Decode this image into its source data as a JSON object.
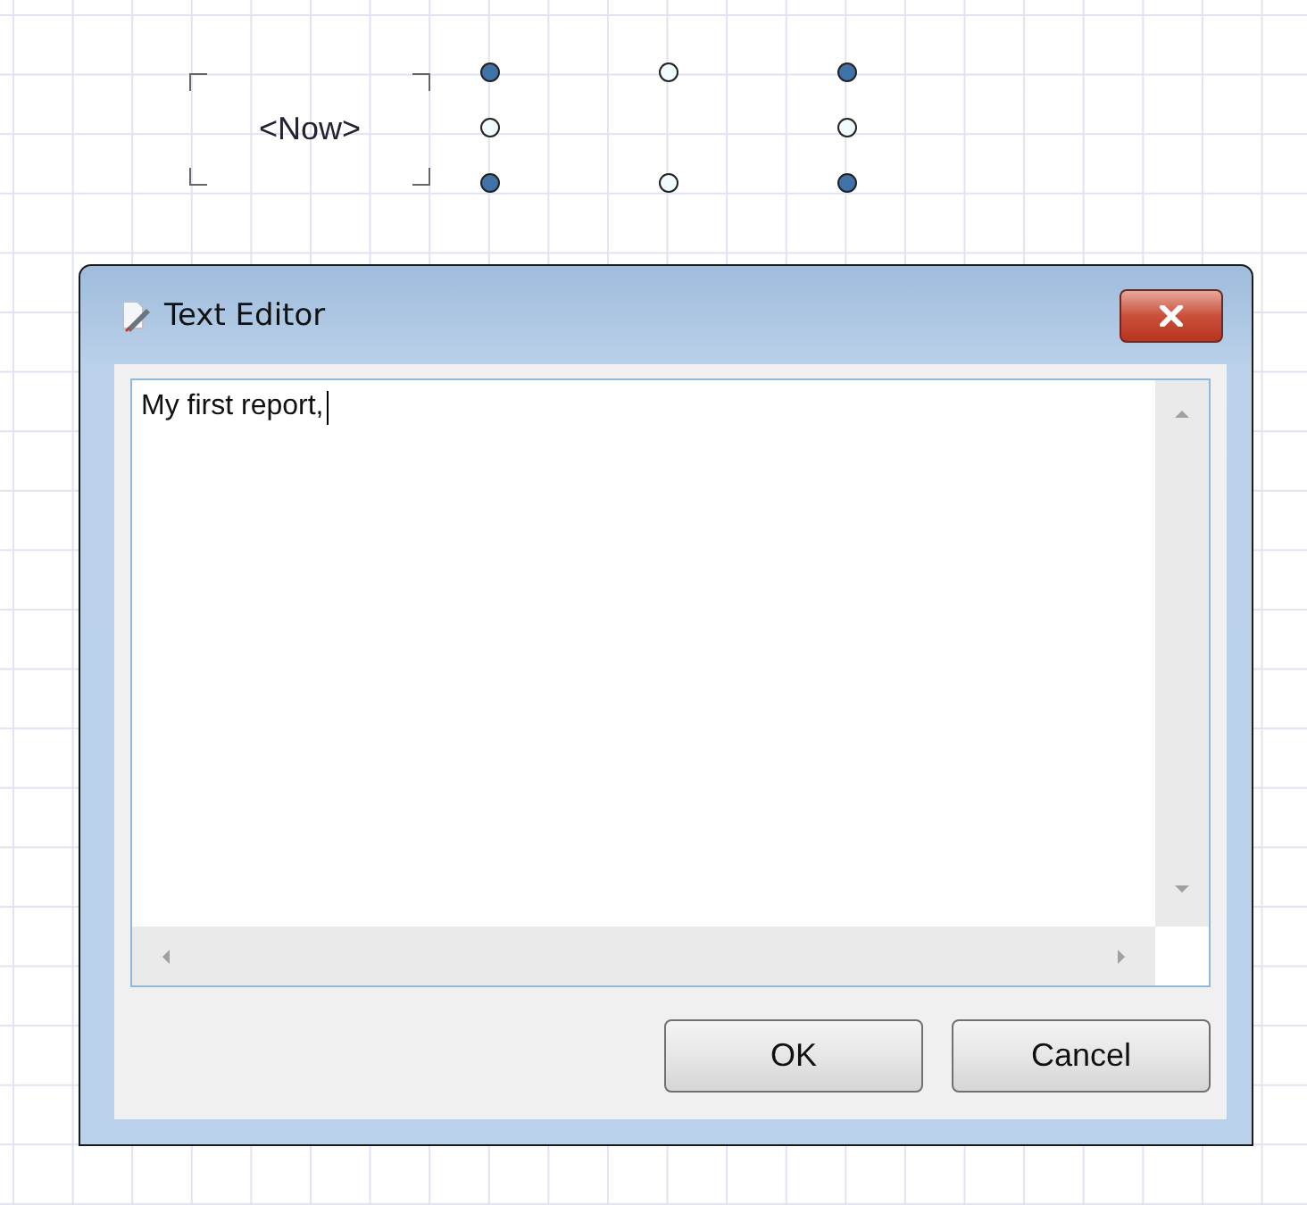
{
  "canvas": {
    "field": {
      "text": "<Now>"
    },
    "handles": [
      {
        "kind": "corner"
      },
      {
        "kind": "edge"
      },
      {
        "kind": "corner"
      },
      {
        "kind": "edge"
      },
      {
        "kind": "edge"
      },
      {
        "kind": "corner"
      },
      {
        "kind": "edge"
      },
      {
        "kind": "corner"
      }
    ]
  },
  "dialog": {
    "title": "Text Editor",
    "text": "My first report,",
    "buttons": [
      {
        "label": "OK"
      },
      {
        "label": "Cancel"
      }
    ]
  }
}
